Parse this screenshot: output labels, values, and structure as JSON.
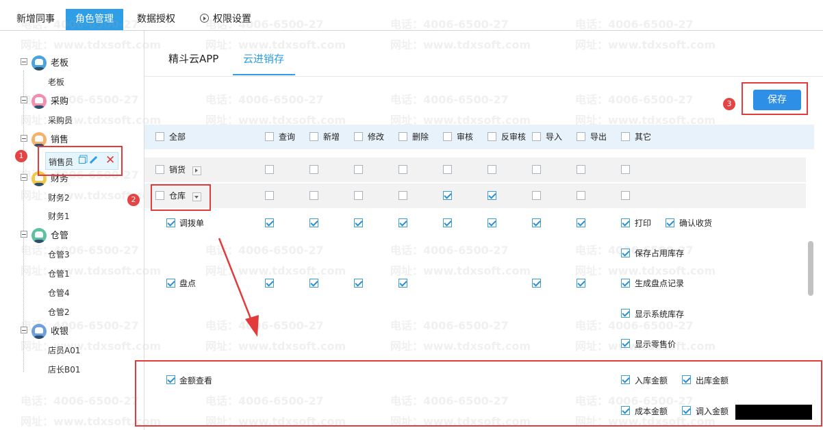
{
  "top_tabs": [
    "新增同事",
    "角色管理",
    "数据授权",
    "权限设置"
  ],
  "tree": {
    "groups": [
      {
        "label": "老板",
        "color": "#4aa3df",
        "children": [
          "老板"
        ]
      },
      {
        "label": "采购",
        "color": "#f08fb0",
        "children": [
          "采购员"
        ]
      },
      {
        "label": "销售",
        "color": "#f5b26b",
        "children": [
          "销售员"
        ]
      },
      {
        "label": "财务",
        "color": "#f2c84b",
        "children": [
          "财务2",
          "财务1"
        ]
      },
      {
        "label": "仓管",
        "color": "#5fc1a0",
        "children": [
          "仓管3",
          "仓管1",
          "仓管4",
          "仓管2"
        ]
      },
      {
        "label": "收银",
        "color": "#6ea0e0",
        "children": [
          "店员A01",
          "店长B01"
        ]
      }
    ]
  },
  "sub_tabs": [
    "精斗云APP",
    "云进销存"
  ],
  "save_label": "保存",
  "badges": [
    "1",
    "2",
    "3"
  ],
  "header_cols": [
    "全部",
    "查询",
    "新增",
    "修改",
    "删除",
    "审核",
    "反审核",
    "导入",
    "导出",
    "其它"
  ],
  "rows": {
    "sales": "销货",
    "warehouse": "仓库",
    "transfer": "调拨单",
    "stocktake": "盘点",
    "amount": "金额查看"
  },
  "other_options": {
    "print": "打印",
    "confirm_receipt": "确认收货",
    "save_occupied_stock": "保存占用库存",
    "gen_stocktake_record": "生成盘点记录",
    "show_system_stock": "显示系统库存",
    "show_retail_price": "显示零售价",
    "in_amount": "入库金额",
    "out_amount": "出库金额",
    "cost_amount": "成本金额",
    "transfer_in_amount": "调入金额"
  },
  "watermark": {
    "phone": "电话：4006-6500-27",
    "site": "网址：www.tdxsoft.com"
  },
  "colors": {
    "accent": "#2e9ee6",
    "highlight": "#e23b3b"
  }
}
